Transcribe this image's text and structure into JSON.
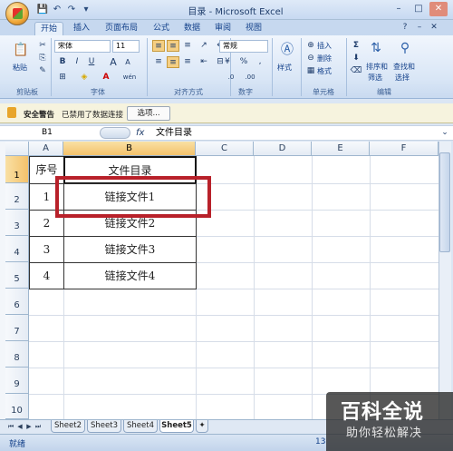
{
  "window": {
    "title": "目录 - Microsoft Excel",
    "minimize": "–",
    "maximize": "□",
    "close": "✕"
  },
  "quick_access": [
    "💾",
    "↶",
    "↷",
    "▾"
  ],
  "tabs": [
    "开始",
    "插入",
    "页面布局",
    "公式",
    "数据",
    "审阅",
    "视图"
  ],
  "ribbon": {
    "clipboard": {
      "label": "剪贴板",
      "paste": "粘贴"
    },
    "font": {
      "label": "字体",
      "font_name": "宋体",
      "font_size": "11",
      "bold": "B",
      "italic": "I",
      "underline": "U",
      "grow": "A",
      "shrink": "A",
      "font_color": "A",
      "phonetic": "wén"
    },
    "alignment": {
      "label": "对齐方式"
    },
    "number": {
      "label": "数字",
      "format": "常规",
      "percent": "%",
      "comma": ",",
      "increase": ".0",
      "decrease": ".00"
    },
    "styles": {
      "label": "样式"
    },
    "cells": {
      "label": "单元格",
      "insert": "插入",
      "delete": "删除",
      "format": "格式"
    },
    "editing": {
      "label": "编辑",
      "sort": "排序和",
      "filter": "筛选",
      "find": "查找和",
      "select": "选择"
    }
  },
  "security": {
    "title": "安全警告",
    "message": "已禁用了数据连接",
    "options": "选项..."
  },
  "formula_bar": {
    "cell_ref": "B1",
    "fx": "fx",
    "value": "文件目录"
  },
  "grid": {
    "columns": [
      "A",
      "B",
      "C",
      "D",
      "E",
      "F"
    ],
    "rows": [
      "1",
      "2",
      "3",
      "4",
      "5",
      "6",
      "7",
      "8",
      "9",
      "10"
    ],
    "table": [
      [
        "序号",
        "文件目录"
      ],
      [
        "1",
        "链接文件1"
      ],
      [
        "2",
        "链接文件2"
      ],
      [
        "3",
        "链接文件3"
      ],
      [
        "4",
        "链接文件4"
      ]
    ]
  },
  "sheets": [
    "Sheet2",
    "Sheet3",
    "Sheet4",
    "Sheet5"
  ],
  "status": {
    "text": "就绪",
    "zoom": "13"
  },
  "watermark": {
    "title": "百科全说",
    "subtitle": "助你轻松解决"
  }
}
